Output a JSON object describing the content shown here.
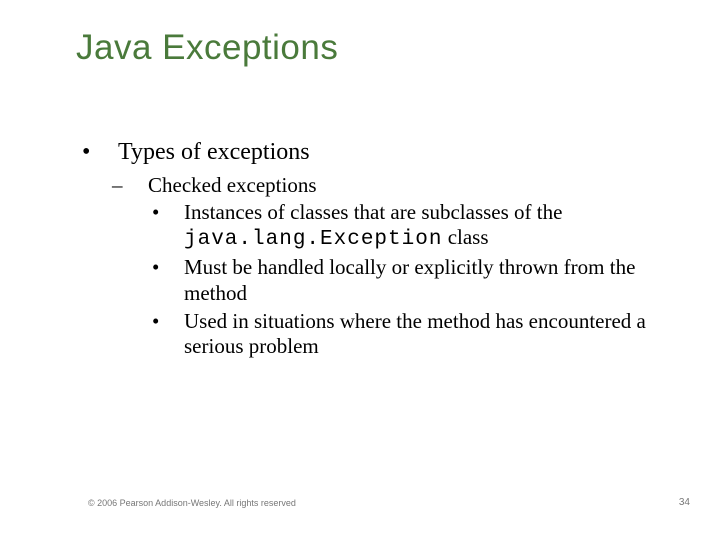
{
  "title": "Java Exceptions",
  "l1": "Types of exceptions",
  "l2_1": "Checked exceptions",
  "l3_1_pre": "Instances of classes that are subclasses of the",
  "l3_1_code": "java.lang.Exception",
  "l3_1_post": " class",
  "l3_2": "Must be handled locally or explicitly thrown from the method",
  "l3_3": "Used in situations where the method has encountered a serious problem",
  "copyright": "© 2006 Pearson Addison-Wesley. All rights reserved",
  "page": "34"
}
